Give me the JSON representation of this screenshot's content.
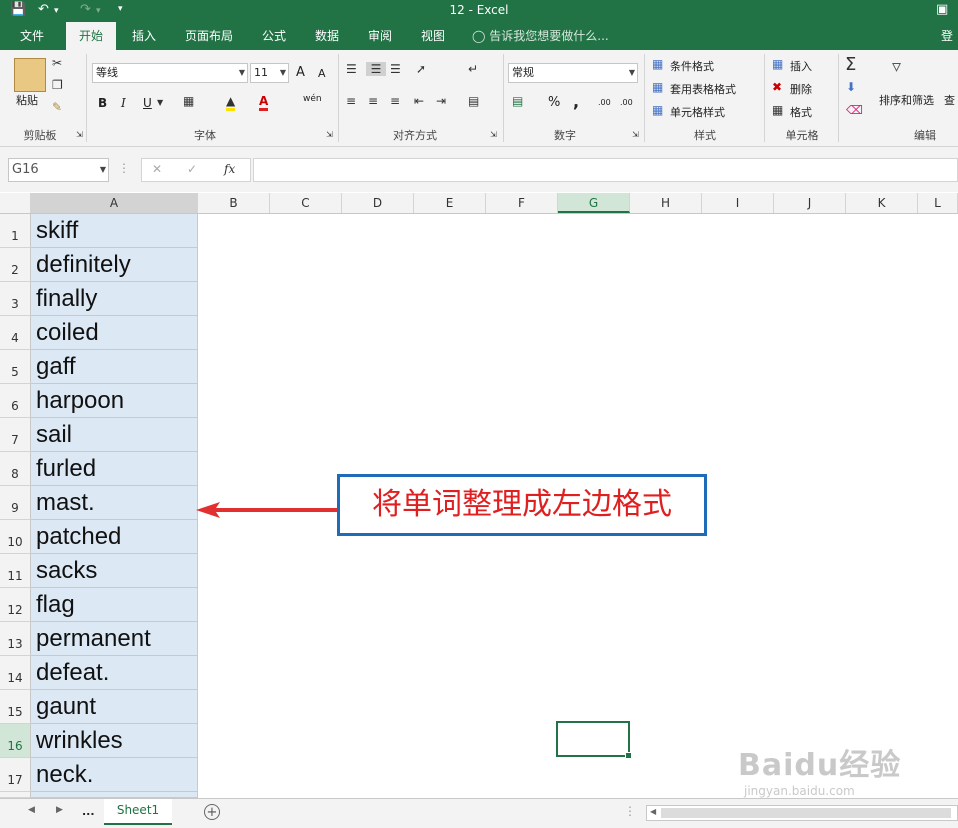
{
  "window": {
    "title": "12 - Excel",
    "undo_icon": "undo-icon",
    "redo_icon": "redo-icon",
    "save_icon": "save-icon"
  },
  "tabs": [
    {
      "label": "文件"
    },
    {
      "label": "开始"
    },
    {
      "label": "插入"
    },
    {
      "label": "页面布局"
    },
    {
      "label": "公式"
    },
    {
      "label": "数据"
    },
    {
      "label": "审阅"
    },
    {
      "label": "视图"
    }
  ],
  "tell_me": "告诉我您想要做什么...",
  "signin": "登",
  "ribbon": {
    "clipboard": {
      "paste": "粘贴",
      "label": "剪贴板"
    },
    "font": {
      "name": "等线",
      "size": "11",
      "bold": "B",
      "italic": "I",
      "underline": "U",
      "wen": "wén",
      "label": "字体",
      "grow": "A",
      "shrink": "A"
    },
    "alignment": {
      "label": "对齐方式"
    },
    "number": {
      "format": "常规",
      "percent": "%",
      "comma": ",",
      "label": "数字",
      "inc": ".00",
      "dec": ".00"
    },
    "styles": {
      "conditional": "条件格式",
      "table": "套用表格格式",
      "cell": "单元格样式",
      "label": "样式"
    },
    "cells": {
      "insert": "插入",
      "delete": "删除",
      "format": "格式",
      "label": "单元格"
    },
    "editing": {
      "sort": "排序和筛选",
      "find": "查",
      "label": "编辑"
    }
  },
  "formula_bar": {
    "name_box": "G16",
    "fx": "fx",
    "value": ""
  },
  "columns": [
    "A",
    "B",
    "C",
    "D",
    "E",
    "F",
    "G",
    "H",
    "I",
    "J",
    "K",
    "L"
  ],
  "selected_column": "G",
  "rows": [
    {
      "n": "1",
      "a": "skiff"
    },
    {
      "n": "2",
      "a": "definitely"
    },
    {
      "n": "3",
      "a": "finally"
    },
    {
      "n": "4",
      "a": "coiled"
    },
    {
      "n": "5",
      "a": "gaff"
    },
    {
      "n": "6",
      "a": "harpoon"
    },
    {
      "n": "7",
      "a": "sail"
    },
    {
      "n": "8",
      "a": "furled"
    },
    {
      "n": "9",
      "a": "mast."
    },
    {
      "n": "10",
      "a": "patched"
    },
    {
      "n": "11",
      "a": "sacks"
    },
    {
      "n": "12",
      "a": "flag"
    },
    {
      "n": "13",
      "a": "permanent"
    },
    {
      "n": "14",
      "a": "defeat."
    },
    {
      "n": "15",
      "a": "gaunt"
    },
    {
      "n": "16",
      "a": "wrinkles"
    },
    {
      "n": "17",
      "a": "neck."
    }
  ],
  "callout": "将单词整理成左边格式",
  "sheet_tabs": {
    "dots": "...",
    "active": "Sheet1",
    "add": "+"
  },
  "watermark": {
    "brand": "Baidu经验",
    "url": "jingyan.baidu.com"
  },
  "colors": {
    "accent": "#217346",
    "selection_fill": "#dce9f5",
    "callout_text": "#e02020",
    "callout_border": "#1e6bb8"
  }
}
